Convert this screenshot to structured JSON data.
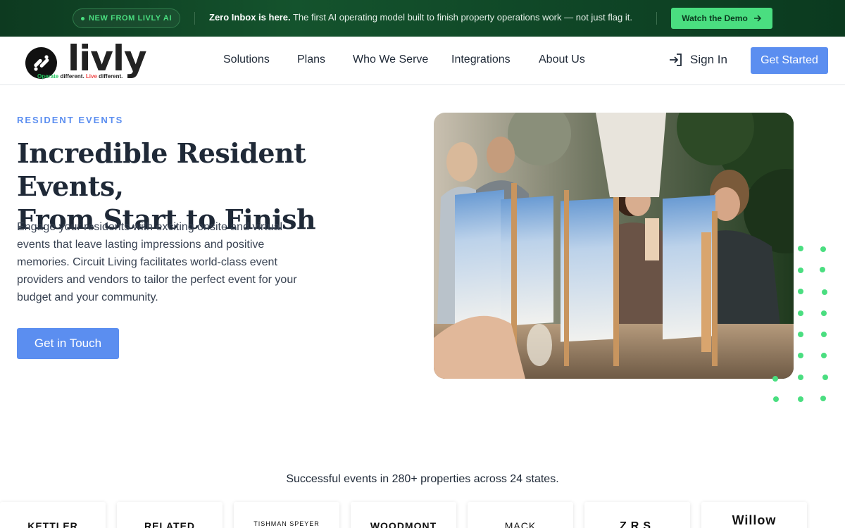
{
  "announcement": {
    "pill": "NEW FROM LIVLY AI",
    "headline": "Zero Inbox is here.",
    "message": "The first AI operating model built to finish property operations work — not just flag it.",
    "cta": "Watch the Demo"
  },
  "brand": {
    "name": "livly",
    "tagline_1": "Operate",
    "tagline_2": " different. ",
    "tagline_3": "Live",
    "tagline_4": " different."
  },
  "nav": {
    "items": [
      "Solutions",
      "Plans",
      "Who We Serve",
      "Integrations",
      "About Us"
    ],
    "sign_in": "Sign In",
    "get_started": "Get Started"
  },
  "hero": {
    "eyebrow": "RESIDENT EVENTS",
    "title_line1": "Incredible Resident Events,",
    "title_line2": "From Start to Finish",
    "body": "Engage your residents with exciting onsite and virtual events that leave lasting impressions and positive memories. Circuit Living facilitates world-class event providers and vendors to tailor the perfect event for your budget and your community.",
    "cta": "Get in Touch"
  },
  "stats": {
    "text": "Successful events in 280+ properties across 24 states."
  },
  "partner_logos": [
    "KETTLER",
    "RELATED",
    "TISHMAN SPEYER",
    "WOODMONT",
    "MACK",
    "ZRS",
    "Willow"
  ],
  "colors": {
    "accent_blue": "#5b8ef0",
    "announce_green": "#14532d",
    "bright_green": "#4ade80"
  }
}
